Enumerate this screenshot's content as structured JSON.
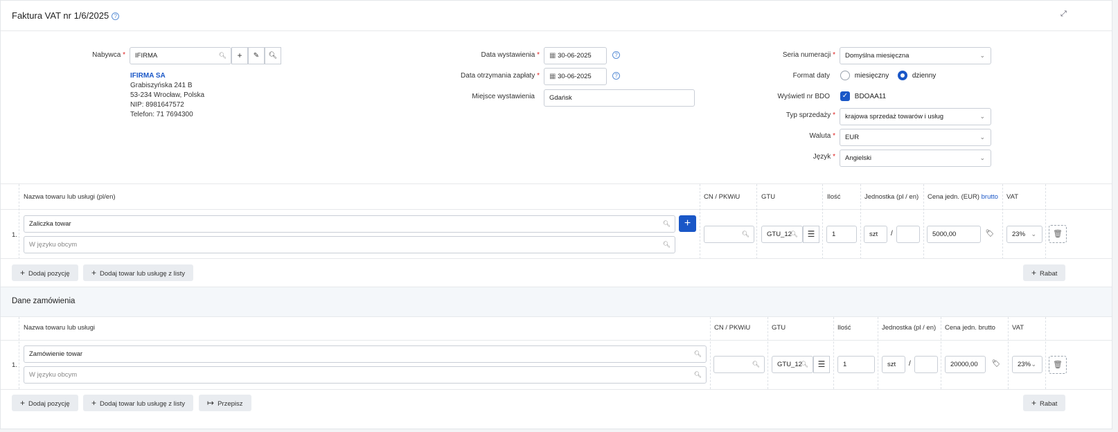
{
  "header": {
    "title": "Faktura VAT nr 1/6/2025",
    "help_icon": "question-circle-icon",
    "expand_icon": "expand-icon"
  },
  "buyer": {
    "label": "Nabywca",
    "value": "IFIRMA",
    "name": "IFIRMA SA",
    "address1": "Grabiszyńska 241 B",
    "address2": "53-234 Wrocław, Polska",
    "nip": "NIP: 8981647572",
    "phone": "Telefon: 71 7694300"
  },
  "dates": {
    "issue_label": "Data wystawienia",
    "issue_value": "30-06-2025",
    "received_label": "Data otrzymania zapłaty",
    "received_value": "30-06-2025",
    "place_label": "Miejsce wystawienia",
    "place_value": "Gdańsk"
  },
  "settings": {
    "series_label": "Seria numeracji",
    "series_value": "Domyślna miesięczna",
    "date_format_label": "Format daty",
    "date_format_opt1": "miesięczny",
    "date_format_opt2": "dzienny",
    "date_format_selected": "dzienny",
    "bdo_label": "Wyświetl nr BDO",
    "bdo_value": "BDOAA11",
    "sale_type_label": "Typ sprzedaży",
    "sale_type_value": "krajowa sprzedaż towarów i usług",
    "currency_label": "Waluta",
    "currency_value": "EUR",
    "language_label": "Język",
    "language_value": "Angielski"
  },
  "items": {
    "headers": {
      "name": "Nazwa towaru lub usługi (pl/en)",
      "cn": "CN / PKWiU",
      "gtu": "GTU",
      "qty": "Ilość",
      "unit": "Jednostka (pl / en)",
      "price": "Cena jedn. (EUR)",
      "price_mode": "brutto",
      "vat": "VAT"
    },
    "row": {
      "num": "1.",
      "name": "Zaliczka towar",
      "foreign_placeholder": "W języku obcym",
      "gtu": "GTU_12",
      "qty": "1",
      "unit": "szt",
      "price": "5000,00",
      "vat": "23%"
    },
    "add_position": "Dodaj pozycję",
    "add_from_list": "Dodaj towar lub usługę z listy",
    "discount": "Rabat"
  },
  "order": {
    "section_title": "Dane zamówienia",
    "headers": {
      "name": "Nazwa towaru lub usługi",
      "cn": "CN / PKWiU",
      "gtu": "GTU",
      "qty": "Ilość",
      "unit": "Jednostka (pl / en)",
      "price": "Cena jedn. brutto",
      "vat": "VAT"
    },
    "row": {
      "num": "1.",
      "name": "Zamówienie towar",
      "foreign_placeholder": "W języku obcym",
      "gtu": "GTU_12",
      "qty": "1",
      "unit": "szt",
      "price": "20000,00",
      "vat": "23%"
    },
    "add_position": "Dodaj pozycję",
    "add_from_list": "Dodaj towar lub usługę z listy",
    "copy": "Przepisz",
    "discount": "Rabat"
  },
  "colors": {
    "accent": "#1a57c7",
    "required": "#dd2222",
    "band": "#f4f7fa"
  }
}
